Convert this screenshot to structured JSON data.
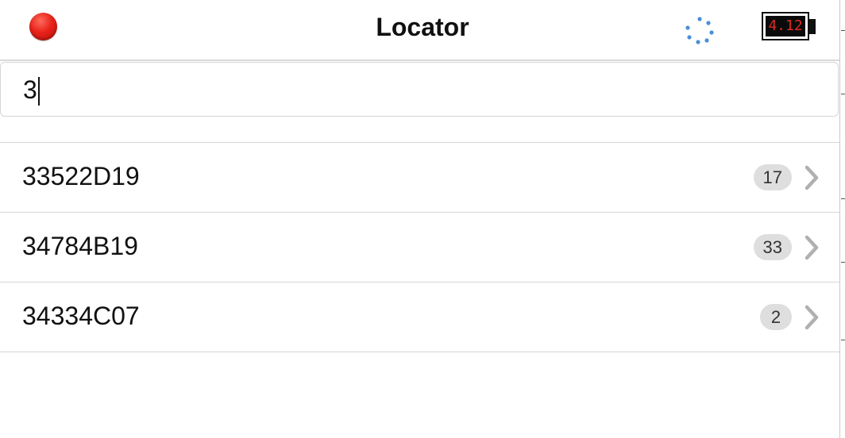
{
  "header": {
    "title": "Locator",
    "record_icon": "red-record-icon",
    "activity_icon": "spinner-icon",
    "battery_value": "4.12",
    "battery_icon": "battery-icon"
  },
  "search": {
    "value": "3"
  },
  "results": [
    {
      "label": "33522D19",
      "count": "17"
    },
    {
      "label": "34784B19",
      "count": "33"
    },
    {
      "label": "34334C07",
      "count": "2"
    }
  ],
  "colors": {
    "accent_blue": "#4a8fd9",
    "record_red": "#e8231a",
    "battery_text": "#e02a1e",
    "badge_bg": "#dedede",
    "chevron": "#b0b0b0"
  }
}
